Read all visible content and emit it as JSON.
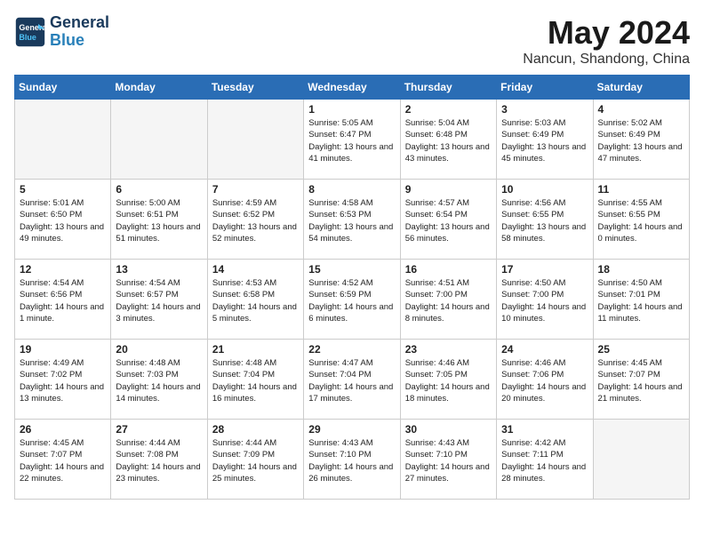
{
  "header": {
    "logo_line1": "General",
    "logo_line2": "Blue",
    "month_title": "May 2024",
    "location": "Nancun, Shandong, China"
  },
  "weekdays": [
    "Sunday",
    "Monday",
    "Tuesday",
    "Wednesday",
    "Thursday",
    "Friday",
    "Saturday"
  ],
  "weeks": [
    [
      {
        "day": "",
        "empty": true
      },
      {
        "day": "",
        "empty": true
      },
      {
        "day": "",
        "empty": true
      },
      {
        "day": "1",
        "sunrise": "5:05 AM",
        "sunset": "6:47 PM",
        "daylight": "13 hours and 41 minutes."
      },
      {
        "day": "2",
        "sunrise": "5:04 AM",
        "sunset": "6:48 PM",
        "daylight": "13 hours and 43 minutes."
      },
      {
        "day": "3",
        "sunrise": "5:03 AM",
        "sunset": "6:49 PM",
        "daylight": "13 hours and 45 minutes."
      },
      {
        "day": "4",
        "sunrise": "5:02 AM",
        "sunset": "6:49 PM",
        "daylight": "13 hours and 47 minutes."
      }
    ],
    [
      {
        "day": "5",
        "sunrise": "5:01 AM",
        "sunset": "6:50 PM",
        "daylight": "13 hours and 49 minutes."
      },
      {
        "day": "6",
        "sunrise": "5:00 AM",
        "sunset": "6:51 PM",
        "daylight": "13 hours and 51 minutes."
      },
      {
        "day": "7",
        "sunrise": "4:59 AM",
        "sunset": "6:52 PM",
        "daylight": "13 hours and 52 minutes."
      },
      {
        "day": "8",
        "sunrise": "4:58 AM",
        "sunset": "6:53 PM",
        "daylight": "13 hours and 54 minutes."
      },
      {
        "day": "9",
        "sunrise": "4:57 AM",
        "sunset": "6:54 PM",
        "daylight": "13 hours and 56 minutes."
      },
      {
        "day": "10",
        "sunrise": "4:56 AM",
        "sunset": "6:55 PM",
        "daylight": "13 hours and 58 minutes."
      },
      {
        "day": "11",
        "sunrise": "4:55 AM",
        "sunset": "6:55 PM",
        "daylight": "14 hours and 0 minutes."
      }
    ],
    [
      {
        "day": "12",
        "sunrise": "4:54 AM",
        "sunset": "6:56 PM",
        "daylight": "14 hours and 1 minute."
      },
      {
        "day": "13",
        "sunrise": "4:54 AM",
        "sunset": "6:57 PM",
        "daylight": "14 hours and 3 minutes."
      },
      {
        "day": "14",
        "sunrise": "4:53 AM",
        "sunset": "6:58 PM",
        "daylight": "14 hours and 5 minutes."
      },
      {
        "day": "15",
        "sunrise": "4:52 AM",
        "sunset": "6:59 PM",
        "daylight": "14 hours and 6 minutes."
      },
      {
        "day": "16",
        "sunrise": "4:51 AM",
        "sunset": "7:00 PM",
        "daylight": "14 hours and 8 minutes."
      },
      {
        "day": "17",
        "sunrise": "4:50 AM",
        "sunset": "7:00 PM",
        "daylight": "14 hours and 10 minutes."
      },
      {
        "day": "18",
        "sunrise": "4:50 AM",
        "sunset": "7:01 PM",
        "daylight": "14 hours and 11 minutes."
      }
    ],
    [
      {
        "day": "19",
        "sunrise": "4:49 AM",
        "sunset": "7:02 PM",
        "daylight": "14 hours and 13 minutes."
      },
      {
        "day": "20",
        "sunrise": "4:48 AM",
        "sunset": "7:03 PM",
        "daylight": "14 hours and 14 minutes."
      },
      {
        "day": "21",
        "sunrise": "4:48 AM",
        "sunset": "7:04 PM",
        "daylight": "14 hours and 16 minutes."
      },
      {
        "day": "22",
        "sunrise": "4:47 AM",
        "sunset": "7:04 PM",
        "daylight": "14 hours and 17 minutes."
      },
      {
        "day": "23",
        "sunrise": "4:46 AM",
        "sunset": "7:05 PM",
        "daylight": "14 hours and 18 minutes."
      },
      {
        "day": "24",
        "sunrise": "4:46 AM",
        "sunset": "7:06 PM",
        "daylight": "14 hours and 20 minutes."
      },
      {
        "day": "25",
        "sunrise": "4:45 AM",
        "sunset": "7:07 PM",
        "daylight": "14 hours and 21 minutes."
      }
    ],
    [
      {
        "day": "26",
        "sunrise": "4:45 AM",
        "sunset": "7:07 PM",
        "daylight": "14 hours and 22 minutes."
      },
      {
        "day": "27",
        "sunrise": "4:44 AM",
        "sunset": "7:08 PM",
        "daylight": "14 hours and 23 minutes."
      },
      {
        "day": "28",
        "sunrise": "4:44 AM",
        "sunset": "7:09 PM",
        "daylight": "14 hours and 25 minutes."
      },
      {
        "day": "29",
        "sunrise": "4:43 AM",
        "sunset": "7:10 PM",
        "daylight": "14 hours and 26 minutes."
      },
      {
        "day": "30",
        "sunrise": "4:43 AM",
        "sunset": "7:10 PM",
        "daylight": "14 hours and 27 minutes."
      },
      {
        "day": "31",
        "sunrise": "4:42 AM",
        "sunset": "7:11 PM",
        "daylight": "14 hours and 28 minutes."
      },
      {
        "day": "",
        "empty": true
      }
    ]
  ],
  "labels": {
    "sunrise": "Sunrise:",
    "sunset": "Sunset:",
    "daylight": "Daylight:"
  }
}
